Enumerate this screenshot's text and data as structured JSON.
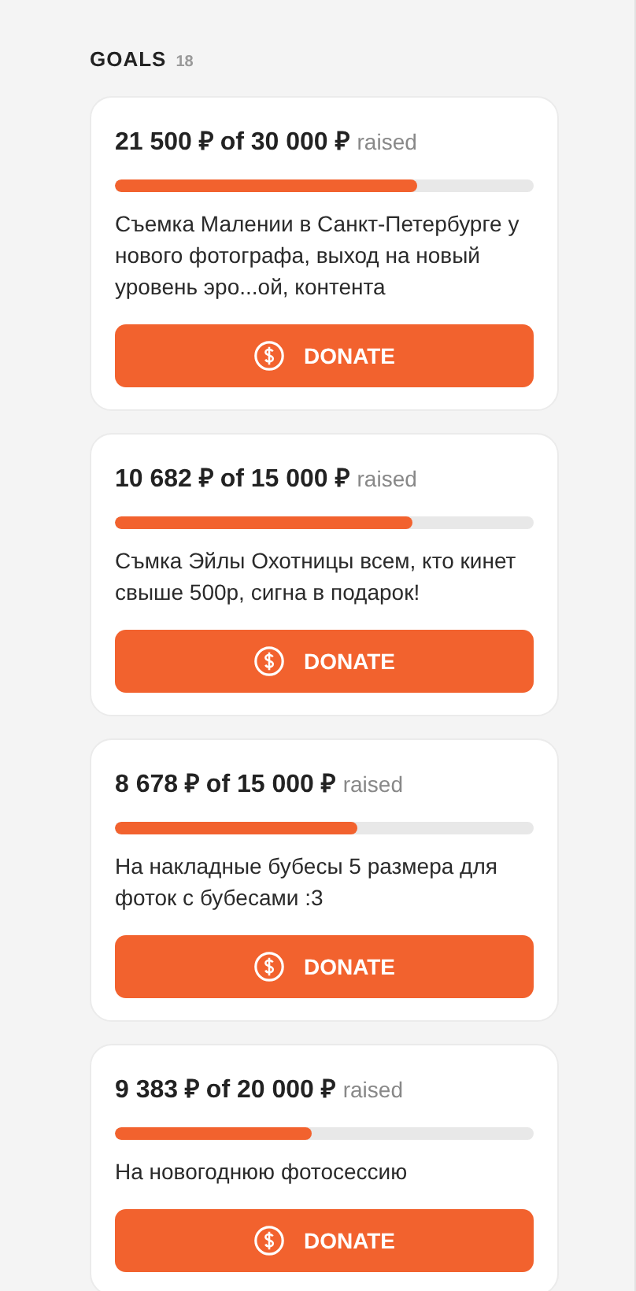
{
  "section": {
    "title": "GOALS",
    "count": "18"
  },
  "goals": [
    {
      "amount": "21 500 ₽ of 30 000 ₽",
      "suffix": "raised",
      "level": 0.72,
      "description": "Съемка Малении в Санкт-Петербурге у нового фотографа, выход на новый уровень эро...ой, контента",
      "button": "DONATE"
    },
    {
      "amount": "10 682 ₽ of 15 000 ₽",
      "suffix": "raised",
      "level": 0.71,
      "description": "Съмка Эйлы Охотницы всем, кто кинет свыше 500р, сигна в подарок!",
      "button": "DONATE"
    },
    {
      "amount": "8 678 ₽ of 15 000 ₽",
      "suffix": "raised",
      "level": 0.58,
      "description": "На накладные бубесы 5 размера для фоток с бубесами :3",
      "button": "DONATE"
    },
    {
      "amount": "9 383 ₽ of 20 000 ₽",
      "suffix": "raised",
      "level": 0.47,
      "description": "На новогоднюю фотосессию",
      "button": "DONATE"
    }
  ]
}
